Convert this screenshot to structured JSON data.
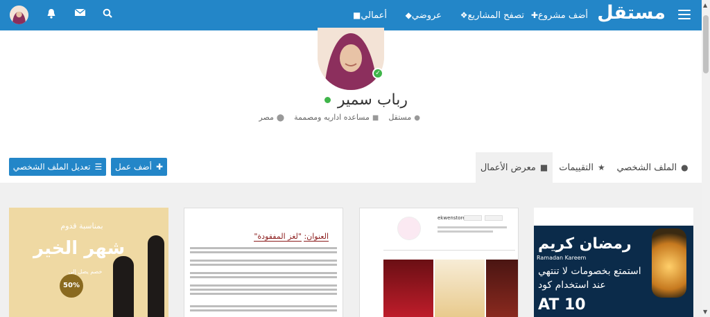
{
  "topbar": {
    "logo": "مستقل",
    "add_project": "أضف مشروع",
    "browse_projects": "تصفح المشاريع",
    "my_offers": "عروضي",
    "my_works": "أعمالي"
  },
  "profile": {
    "name": "رباب سمير",
    "account_type": "مستقل",
    "job_title": "مساعده اداريه ومصممة",
    "country": "مصر"
  },
  "actions": {
    "add_work": "أضف عمل",
    "edit_profile": "تعديل الملف الشخصي"
  },
  "tabs": [
    {
      "label": "الملف الشخصي"
    },
    {
      "label": "التقييمات"
    },
    {
      "label": "معرض الأعمال"
    }
  ],
  "portfolio": [
    {
      "heading": "بمناسبة قدوم",
      "big_text": "شهر الخير",
      "sub": "خصم يصل إلى",
      "badge": "50%"
    },
    {
      "title_label": "العنوان:",
      "title": "\"لغز المفقودة\""
    },
    {
      "store": "ekwenstore"
    },
    {
      "title": "رمضان كريم",
      "sub": "Ramadan Kareem",
      "line1": "استمتع بخصومات لا تنتهي",
      "line2": "عند استخدام كود",
      "code": "AT 10"
    }
  ]
}
